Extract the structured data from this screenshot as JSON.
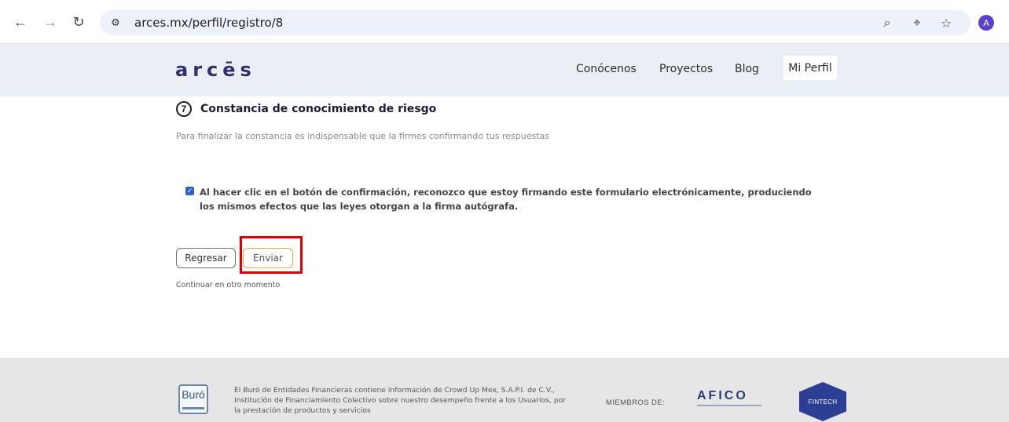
{
  "browser": {
    "url": "arces.mx/perfil/registro/8",
    "avatar_initial": "A",
    "icons": [
      "back-arrow-icon",
      "forward-arrow-icon",
      "reload-icon",
      "site-settings-icon",
      "zoom-icon",
      "location-icon",
      "bookmark-star-icon"
    ]
  },
  "site": {
    "logo": "arcēs",
    "nav": [
      "Conócenos",
      "Proyectos",
      "Blog"
    ],
    "active_nav": "Mi Perfil"
  },
  "step": {
    "number": "7",
    "title": "Constancia de conocimiento de riesgo",
    "description": "Para finalizar la constancia es indispensable que la firmes confirmando tus respuestas"
  },
  "consent": {
    "checked": true,
    "text": "Al hacer clic en el botón de confirmación, reconozco que estoy firmando este formulario electrónicamente, produciendo los mismos efectos que las leyes otorgan a la firma autógrafa."
  },
  "actions": {
    "back_label": "Regresar",
    "send_label": "Enviar",
    "later_link": "Continuar en otro momento"
  },
  "footer": {
    "buro_logo": "Buró",
    "text": "El Buró de Entidades Financieras contiene información de Crowd Up Mex, S.A.P.I. de C.V., Institución de Financiamiento Colectivo sobre nuestro desempeño frente a los Usuarios, por la prestación de productos y servicios",
    "members_label": "MIEMBROS DE:",
    "afico_logo": "AFICO",
    "fintech_logo": "FINTECH"
  },
  "colors": {
    "header_bg": "#e9eff4",
    "footer_bg": "#e6e6e6",
    "checkbox": "#2d5fd3",
    "highlight": "#e00000",
    "send_border": "#e9a94a"
  }
}
